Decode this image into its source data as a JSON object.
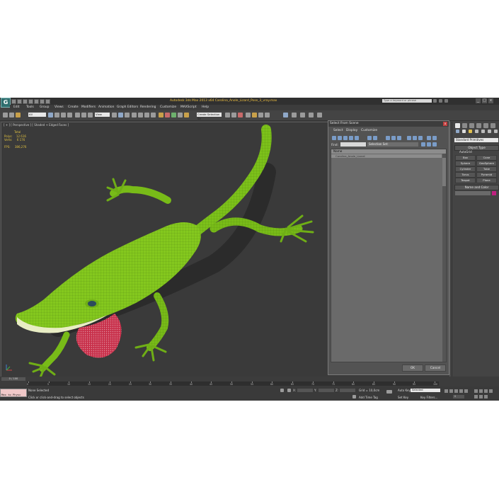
{
  "title_bar": {
    "app_title": "Autodesk 3ds Max 2013 x64     Carolina_Anole_Lizard_Pose_3_vray.max",
    "search_placeholder": "Type a keyword or phrase"
  },
  "menu": [
    "Edit",
    "Tools",
    "Group",
    "Views",
    "Create",
    "Modifiers",
    "Animation",
    "Graph Editors",
    "Rendering",
    "Customize",
    "MAXScript",
    "Help"
  ],
  "toolbar": {
    "filter_dropdown": "All",
    "coord_dropdown": "View",
    "selection_set": "Create Selection Se"
  },
  "viewport": {
    "label": "[ + ] [ Perspective ] [ Shaded + Edged Faces ]",
    "stats": {
      "total_label": "Total",
      "polys_label": "Polys:",
      "polys_value": "12 616",
      "verts_label": "Verts:",
      "verts_value": "6 176",
      "fps_label": "FPS:",
      "fps_value": "386,276"
    }
  },
  "dialog": {
    "title": "Select From Scene",
    "close": "x",
    "tabs": [
      "Select",
      "Display",
      "Customize"
    ],
    "find_label": "Find:",
    "selection_set": "Selection Set:",
    "column_name": "Name",
    "items": [
      "Carolina_Anole_Lizard"
    ],
    "ok_label": "OK",
    "cancel_label": "Cancel"
  },
  "command_panel": {
    "dropdown": "Standard Primitives",
    "object_type_header": "Object Type",
    "autogrid_label": "AutoGrid",
    "buttons": [
      "Box",
      "Cone",
      "Sphere",
      "GeoSphere",
      "Cylinder",
      "Tube",
      "Torus",
      "Pyramid",
      "Teapot",
      "Plane"
    ],
    "name_color_header": "Name and Color",
    "swatch_color": "#c02080"
  },
  "timeline": {
    "slider_label": "0 / 100",
    "ticks": [
      "0",
      "5",
      "10",
      "15",
      "20",
      "25",
      "30",
      "35",
      "40",
      "45",
      "50",
      "55",
      "60",
      "65",
      "70",
      "75",
      "80",
      "85",
      "90",
      "95",
      "100"
    ]
  },
  "status_bar": {
    "maxscript_text": "Max to Physc",
    "selection_status": "None Selected",
    "prompt": "Click or click-and-drag to select objects",
    "x_label": "X:",
    "y_label": "Y:",
    "z_label": "Z:",
    "grid": "Grid = 10,0cm",
    "auto_key": "Auto Key",
    "selected": "Selected",
    "set_key": "Set Key",
    "key_filters": "Key Filters...",
    "add_time_tag": "Add Time Tag",
    "frame": "0"
  },
  "colors": {
    "lizard_body": "#7cc11a",
    "dewlap": "#c8304a",
    "viewport_bg": "#3a3a3a"
  }
}
